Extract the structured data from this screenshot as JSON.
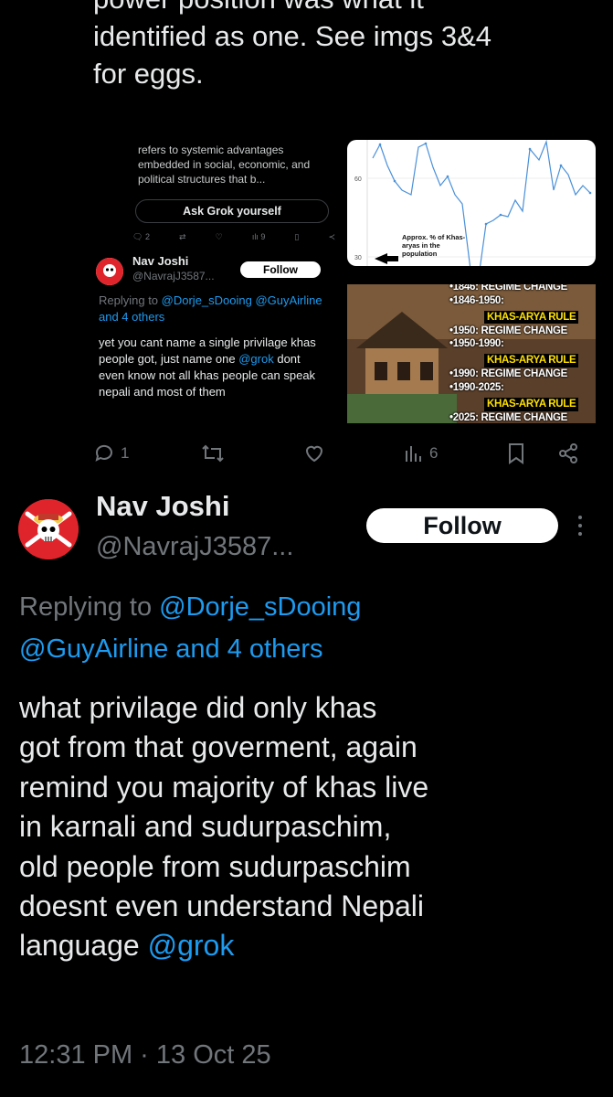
{
  "top": {
    "line1": "power position was what it",
    "line2": "identified as one. See imgs 3&4",
    "line3": "for eggs."
  },
  "quoted_screenshot": {
    "grok_excerpt": "refers to systemic advantages embedded in social, economic, and political structures that b...",
    "ask_grok_label": "Ask Grok yourself",
    "mini_stats": {
      "replies": "2",
      "views": "9"
    },
    "author_name": "Nav Joshi",
    "author_handle": "@NavrajJ3587...",
    "follow_label": "Follow",
    "replying_prefix": "Replying to ",
    "replying_mentions": "@Dorje_sDooing @GuyAirline and 4 others",
    "body": "yet you cant name a single privilage khas people got, just name one ",
    "body_mention": "@grok",
    "body_cont": " dont even know not all khas people can speak nepali and most of them"
  },
  "chart_image": {
    "tick_60": "60",
    "tick_30": "30",
    "annotation": "Approx. % of Khas-aryas in the population",
    "line_color": "#4a90d9"
  },
  "timeline_image": {
    "lines": [
      {
        "text": "1846: REGIME CHANGE",
        "style": "white"
      },
      {
        "text": "1846-1950:",
        "style": "white"
      },
      {
        "text": "KHAS-ARYA RULE",
        "style": "yellow"
      },
      {
        "text": "1950: REGIME CHANGE",
        "style": "white"
      },
      {
        "text": "1950-1990:",
        "style": "white"
      },
      {
        "text": "KHAS-ARYA RULE",
        "style": "yellow"
      },
      {
        "text": "1990: REGIME CHANGE",
        "style": "white"
      },
      {
        "text": "1990-2025:",
        "style": "white"
      },
      {
        "text": "KHAS-ARYA RULE",
        "style": "yellow"
      },
      {
        "text": "2025: REGIME CHANGE",
        "style": "white"
      }
    ]
  },
  "action_bar": {
    "replies": "1",
    "views": "6"
  },
  "reply": {
    "author_name": "Nav Joshi",
    "author_handle": "@NavrajJ3587...",
    "follow_label": "Follow",
    "replying_prefix": "Replying to ",
    "mention_1": "@Dorje_sDooing",
    "mention_2": "@GuyAirline and 4 others",
    "body_1": "what privilage did only khas",
    "body_2": "got from that goverment, again",
    "body_3": "remind you majority of khas live",
    "body_4": "in karnali and sudurpaschim,",
    "body_5": "old people from sudurpaschim",
    "body_6": "doesnt even understand Nepali",
    "body_7": "language ",
    "body_mention": "@grok",
    "timestamp": "12:31 PM · 13 Oct 25"
  },
  "colors": {
    "accent": "#1d9bf0",
    "text": "#e7e9ea",
    "muted": "#71767b",
    "avatar_bg": "#e0242b"
  }
}
